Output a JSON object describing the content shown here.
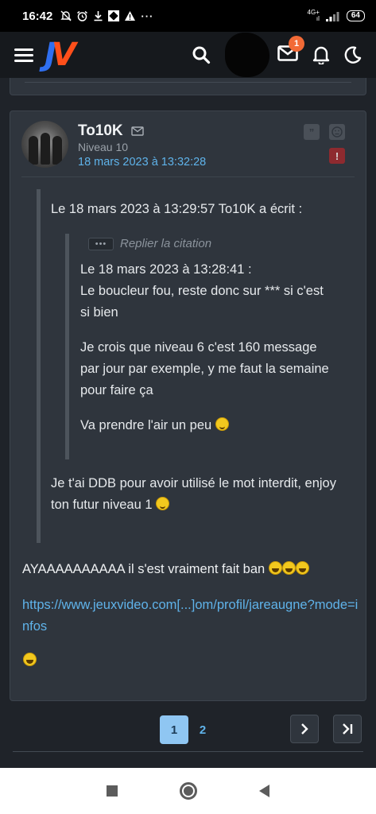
{
  "status_bar": {
    "time": "16:42",
    "network_top": "4G+",
    "network_bottom": "ıl",
    "battery": "64"
  },
  "app_bar": {
    "logo_j": "J",
    "logo_v": "V",
    "notification_count": "1"
  },
  "post": {
    "author": "To10K",
    "level": "Niveau 10",
    "date": "18 mars 2023 à 13:32:28",
    "quote_header": "Le 18 mars 2023 à 13:29:57 To10K a écrit :",
    "reply_toggle_label": "Replier la citation",
    "reply_toggle_dots": "•••",
    "inner_quote": {
      "line1": "Le 18 mars 2023 à 13:28:41 :",
      "line2": "Le boucleur fou, reste donc sur *** si c'est si bien",
      "para2": "Je crois que niveau 6 c'est 160 message par jour par exemple, y me faut la semaine pour faire ça",
      "para3": "Va prendre l'air un peu"
    },
    "quote_reply": "Je t'ai DDB pour avoir utilisé le mot interdit, enjoy ton futur niveau 1",
    "body": "AYAAAAAAAAAA il s'est vraiment fait ban",
    "link": "https://www.jeuxvideo.com[...]om/profil/jareaugne?mode=infos"
  },
  "pagination": {
    "current_page": "1",
    "next_page_number": "2"
  }
}
